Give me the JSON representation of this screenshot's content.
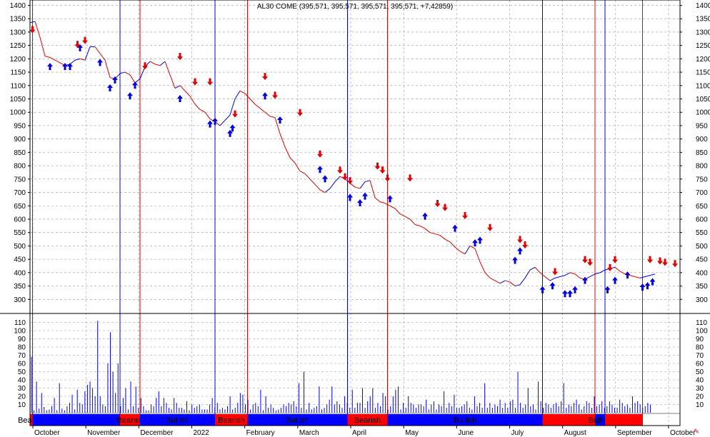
{
  "chart_data": [
    {
      "type": "line",
      "title": "AL30 COME (395,571, 395,571, 395,571, 395,571, +7,42859)",
      "ylim": [
        250,
        1420
      ],
      "yticks": [
        300,
        350,
        400,
        450,
        500,
        550,
        600,
        650,
        700,
        750,
        800,
        850,
        900,
        950,
        1000,
        1050,
        1100,
        1150,
        1200,
        1250,
        1300,
        1350,
        1400
      ],
      "grid": true,
      "x": [
        0,
        2,
        4,
        6,
        8,
        10,
        12,
        14,
        16,
        18,
        20,
        22,
        24,
        26,
        28,
        30,
        32,
        34,
        36,
        38,
        40,
        42,
        44,
        46,
        48,
        50,
        52,
        54,
        56,
        58,
        60,
        62,
        64,
        66,
        68,
        70,
        72,
        74,
        76,
        78,
        80,
        82,
        84,
        86,
        88,
        90,
        92,
        94,
        96,
        98,
        100,
        102,
        104,
        106,
        108,
        110,
        112,
        114,
        116,
        118,
        120,
        122,
        124,
        126,
        128,
        130,
        132,
        134,
        136,
        138,
        140,
        142,
        144,
        146,
        148,
        150,
        152,
        154,
        156,
        158,
        160,
        162,
        164,
        166,
        168,
        170,
        172,
        174,
        176,
        178,
        180,
        182,
        184,
        186,
        188,
        190,
        192,
        194,
        196,
        198,
        200,
        202,
        204,
        206,
        208,
        210,
        212,
        214,
        216,
        218,
        220,
        222,
        224,
        226,
        228,
        230,
        232,
        234,
        236,
        238,
        240,
        242,
        244,
        246,
        248,
        250
      ],
      "series": [
        {
          "name": "AL30",
          "values": [
            1335,
            1340,
            1280,
            1210,
            1205,
            1195,
            1185,
            1175,
            1180,
            1195,
            1200,
            1195,
            1245,
            1245,
            1220,
            1195,
            1130,
            1125,
            1145,
            1150,
            1140,
            1110,
            1125,
            1170,
            1190,
            1180,
            1175,
            1190,
            1140,
            1090,
            1100,
            1080,
            1060,
            1030,
            1010,
            1000,
            975,
            965,
            950,
            970,
            990,
            1050,
            1080,
            1070,
            1050,
            1030,
            1015,
            1000,
            985,
            980,
            920,
            870,
            830,
            810,
            780,
            770,
            750,
            730,
            710,
            700,
            715,
            740,
            760,
            750,
            735,
            720,
            715,
            740,
            745,
            680,
            665,
            660,
            650,
            640,
            620,
            610,
            600,
            580,
            575,
            565,
            550,
            545,
            540,
            525,
            515,
            495,
            480,
            470,
            500,
            490,
            440,
            400,
            380,
            370,
            360,
            370,
            365,
            350,
            355,
            380,
            410,
            420,
            400,
            385,
            370,
            380,
            385,
            390,
            400,
            395,
            380,
            375,
            385,
            395,
            400,
            410,
            415,
            420,
            405,
            395,
            390,
            385,
            380,
            385,
            390,
            395
          ]
        }
      ],
      "up_arrows": [
        {
          "x": 8,
          "y": 1190
        },
        {
          "x": 14,
          "y": 1190
        },
        {
          "x": 16,
          "y": 1190
        },
        {
          "x": 20,
          "y": 1260
        },
        {
          "x": 28,
          "y": 1205
        },
        {
          "x": 32,
          "y": 1110
        },
        {
          "x": 34,
          "y": 1140
        },
        {
          "x": 40,
          "y": 1080
        },
        {
          "x": 42,
          "y": 1120
        },
        {
          "x": 60,
          "y": 1070
        },
        {
          "x": 72,
          "y": 975
        },
        {
          "x": 74,
          "y": 985
        },
        {
          "x": 80,
          "y": 940
        },
        {
          "x": 81,
          "y": 960
        },
        {
          "x": 94,
          "y": 1080
        },
        {
          "x": 100,
          "y": 990
        },
        {
          "x": 116,
          "y": 805
        },
        {
          "x": 118,
          "y": 770
        },
        {
          "x": 128,
          "y": 700
        },
        {
          "x": 132,
          "y": 680
        },
        {
          "x": 134,
          "y": 705
        },
        {
          "x": 144,
          "y": 695
        },
        {
          "x": 158,
          "y": 630
        },
        {
          "x": 170,
          "y": 585
        },
        {
          "x": 178,
          "y": 530
        },
        {
          "x": 180,
          "y": 540
        },
        {
          "x": 194,
          "y": 465
        },
        {
          "x": 196,
          "y": 500
        },
        {
          "x": 205,
          "y": 355
        },
        {
          "x": 209,
          "y": 370
        },
        {
          "x": 214,
          "y": 340
        },
        {
          "x": 216,
          "y": 340
        },
        {
          "x": 218,
          "y": 355
        },
        {
          "x": 222,
          "y": 390
        },
        {
          "x": 231,
          "y": 355
        },
        {
          "x": 234,
          "y": 390
        },
        {
          "x": 239,
          "y": 410
        },
        {
          "x": 245,
          "y": 365
        },
        {
          "x": 247,
          "y": 370
        },
        {
          "x": 249,
          "y": 385
        }
      ],
      "down_arrows": [
        {
          "x": 1,
          "y": 1290
        },
        {
          "x": 19,
          "y": 1235
        },
        {
          "x": 22,
          "y": 1250
        },
        {
          "x": 46,
          "y": 1155
        },
        {
          "x": 60,
          "y": 1190
        },
        {
          "x": 66,
          "y": 1095
        },
        {
          "x": 72,
          "y": 1095
        },
        {
          "x": 82,
          "y": 975
        },
        {
          "x": 94,
          "y": 1115
        },
        {
          "x": 98,
          "y": 1045
        },
        {
          "x": 108,
          "y": 980
        },
        {
          "x": 116,
          "y": 825
        },
        {
          "x": 124,
          "y": 765
        },
        {
          "x": 126,
          "y": 740
        },
        {
          "x": 128,
          "y": 725
        },
        {
          "x": 139,
          "y": 780
        },
        {
          "x": 141,
          "y": 765
        },
        {
          "x": 143,
          "y": 735
        },
        {
          "x": 152,
          "y": 735
        },
        {
          "x": 163,
          "y": 640
        },
        {
          "x": 166,
          "y": 625
        },
        {
          "x": 174,
          "y": 595
        },
        {
          "x": 184,
          "y": 550
        },
        {
          "x": 196,
          "y": 505
        },
        {
          "x": 198,
          "y": 485
        },
        {
          "x": 210,
          "y": 385
        },
        {
          "x": 222,
          "y": 430
        },
        {
          "x": 224,
          "y": 420
        },
        {
          "x": 232,
          "y": 400
        },
        {
          "x": 234,
          "y": 430
        },
        {
          "x": 248,
          "y": 430
        },
        {
          "x": 252,
          "y": 425
        },
        {
          "x": 254,
          "y": 420
        },
        {
          "x": 258,
          "y": 415
        }
      ],
      "signal_lines": [
        {
          "x": 1,
          "color": "#e00000"
        },
        {
          "x": 36,
          "color": "#0000dd"
        },
        {
          "x": 44,
          "color": "#e00000"
        },
        {
          "x": 74,
          "color": "#0000dd"
        },
        {
          "x": 87,
          "color": "#e00000"
        },
        {
          "x": 127,
          "color": "#0000dd"
        },
        {
          "x": 143,
          "color": "#e00000"
        },
        {
          "x": 205,
          "color": "#0000dd"
        },
        {
          "x": 226,
          "color": "#e00000"
        },
        {
          "x": 230,
          "color": "#0000dd"
        },
        {
          "x": 245,
          "color": "#e00000"
        }
      ]
    },
    {
      "type": "bar",
      "ylim": [
        0,
        120
      ],
      "yticks": [
        10,
        20,
        30,
        40,
        50,
        60,
        70,
        80,
        90,
        100,
        110
      ],
      "grid": true,
      "values": [
        68,
        3,
        38,
        5,
        24,
        7,
        3,
        4,
        8,
        18,
        3,
        36,
        5,
        3,
        8,
        12,
        22,
        4,
        28,
        12,
        10,
        26,
        34,
        38,
        30,
        20,
        112,
        20,
        10,
        8,
        60,
        98,
        50,
        24,
        60,
        8,
        18,
        30,
        4,
        38,
        8,
        32,
        6,
        18,
        8,
        3,
        3,
        10,
        8,
        18,
        26,
        8,
        18,
        12,
        6,
        4,
        18,
        12,
        6,
        6,
        4,
        14,
        3,
        10,
        6,
        8,
        10,
        4,
        4,
        4,
        10,
        18,
        6,
        12,
        4,
        6,
        4,
        8,
        20,
        4,
        6,
        12,
        24,
        22,
        10,
        16,
        4,
        10,
        12,
        8,
        28,
        3,
        20,
        6,
        10,
        6,
        3,
        4,
        6,
        10,
        8,
        12,
        10,
        14,
        8,
        36,
        6,
        50,
        4,
        12,
        4,
        6,
        8,
        32,
        4,
        6,
        10,
        16,
        32,
        10,
        14,
        10,
        6,
        20,
        12,
        6,
        28,
        6,
        12,
        12,
        30,
        6,
        14,
        20,
        30,
        6,
        12,
        8,
        24,
        20,
        4,
        8,
        20,
        28,
        32,
        4,
        12,
        6,
        20,
        12,
        10,
        6,
        10,
        10,
        8,
        16,
        4,
        10,
        14,
        4,
        10,
        8,
        26,
        6,
        12,
        8,
        22,
        6,
        6,
        8,
        10,
        14,
        6,
        4,
        20,
        8,
        12,
        6,
        36,
        6,
        12,
        6,
        10,
        8,
        16,
        6,
        12,
        6,
        14,
        16,
        6,
        50,
        12,
        6,
        10,
        30,
        8,
        10,
        4,
        38,
        14,
        6,
        12,
        10,
        6,
        10,
        12,
        8,
        14,
        36,
        6,
        10,
        8,
        12,
        16,
        10,
        4,
        8,
        14,
        12,
        6,
        20,
        8,
        10,
        14,
        6,
        8,
        14,
        10,
        6,
        6,
        16,
        12,
        8,
        10,
        6,
        20,
        12,
        14,
        10,
        6,
        8,
        12,
        10
      ]
    }
  ],
  "chart": {
    "title": "AL30 COME (395,571, 395,571, 395,571, 395,571, +7,42859)",
    "price_axis_labels": [
      "1400",
      "1350",
      "1300",
      "1250",
      "1200",
      "1150",
      "1100",
      "1050",
      "1000",
      "950",
      "900",
      "850",
      "800",
      "750",
      "700",
      "650",
      "600",
      "550",
      "500",
      "450",
      "400",
      "350",
      "300"
    ],
    "volume_axis_labels": [
      "110",
      "100",
      "90",
      "80",
      "70",
      "60",
      "50",
      "40",
      "30",
      "20",
      "10"
    ],
    "months": [
      "October",
      "November",
      "December",
      "2022",
      "February",
      "March",
      "April",
      "May",
      "June",
      "July",
      "August",
      "September",
      "October"
    ],
    "bands": [
      {
        "label": "Bearish",
        "color": "#ff0000"
      },
      {
        "label": "",
        "color": "#0000ff"
      },
      {
        "label": "Bearish",
        "color": "#ff0000"
      },
      {
        "label": "Bullish",
        "color": "#0000ff"
      },
      {
        "label": "Bearish",
        "color": "#ff0000"
      },
      {
        "label": "Bullish",
        "color": "#0000ff"
      },
      {
        "label": "Bearish",
        "color": "#ff0000"
      },
      {
        "label": "Bullish",
        "color": "#0000ff"
      },
      {
        "label": "",
        "color": "#ff0000"
      },
      {
        "label": "Bullish",
        "color": "#0000ff"
      },
      {
        "label": "",
        "color": "#ff0000"
      }
    ],
    "colors": {
      "up": "#0000dd",
      "down": "#e00000",
      "bull": "#0000ff",
      "bear": "#ff0000",
      "volume": "#0000ff"
    }
  }
}
